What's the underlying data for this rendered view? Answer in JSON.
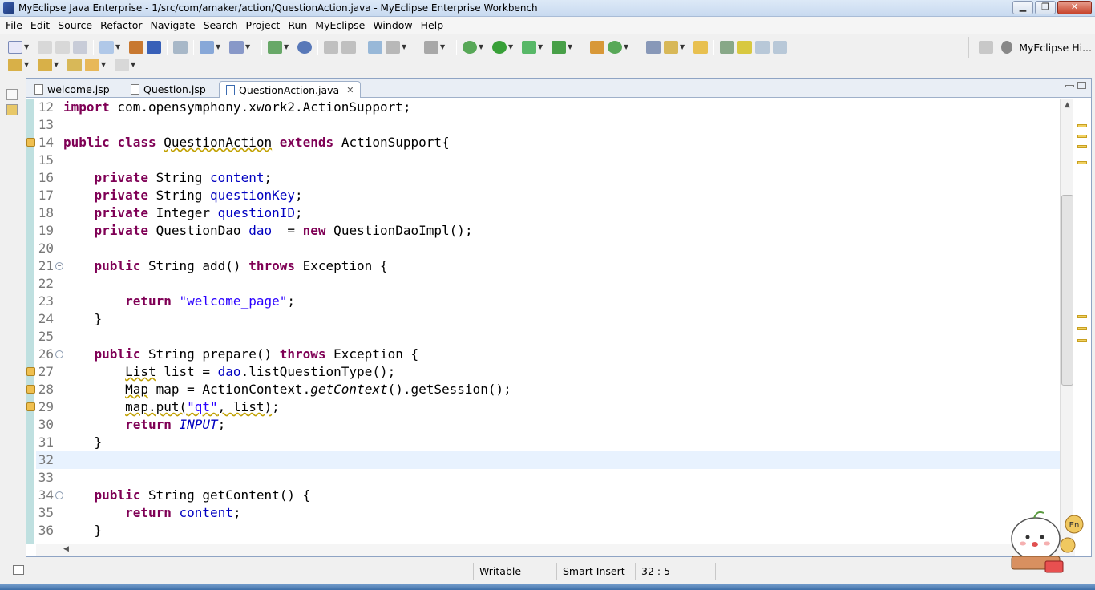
{
  "window": {
    "title": "MyEclipse Java Enterprise - 1/src/com/amaker/action/QuestionAction.java - MyEclipse Enterprise Workbench"
  },
  "menu": [
    "File",
    "Edit",
    "Source",
    "Refactor",
    "Navigate",
    "Search",
    "Project",
    "Run",
    "MyEclipse",
    "Window",
    "Help"
  ],
  "perspective": {
    "label": "MyEclipse Hi..."
  },
  "tabs": [
    {
      "label": "welcome.jsp"
    },
    {
      "label": "Question.jsp"
    },
    {
      "label": "QuestionAction.java",
      "close": "✕"
    }
  ],
  "code": {
    "current_line": 32,
    "lines": [
      {
        "n": "12",
        "t": "import com.opensymphony.xwork2.ActionSupport;"
      },
      {
        "n": "13",
        "t": ""
      },
      {
        "n": "14",
        "t": "public class QuestionAction extends ActionSupport{"
      },
      {
        "n": "15",
        "t": ""
      },
      {
        "n": "16",
        "t": "    private String content;"
      },
      {
        "n": "17",
        "t": "    private String questionKey;"
      },
      {
        "n": "18",
        "t": "    private Integer questionID;"
      },
      {
        "n": "19",
        "t": "    private QuestionDao dao  = new QuestionDaoImpl();"
      },
      {
        "n": "20",
        "t": ""
      },
      {
        "n": "21",
        "t": "    public String add() throws Exception {"
      },
      {
        "n": "22",
        "t": ""
      },
      {
        "n": "23",
        "t": "        return \"welcome_page\";"
      },
      {
        "n": "24",
        "t": "    }"
      },
      {
        "n": "25",
        "t": ""
      },
      {
        "n": "26",
        "t": "    public String prepare() throws Exception {"
      },
      {
        "n": "27",
        "t": "        List list = dao.listQuestionType();"
      },
      {
        "n": "28",
        "t": "        Map map = ActionContext.getContext().getSession();"
      },
      {
        "n": "29",
        "t": "        map.put(\"qt\", list);"
      },
      {
        "n": "30",
        "t": "        return INPUT;"
      },
      {
        "n": "31",
        "t": "    }"
      },
      {
        "n": "32",
        "t": ""
      },
      {
        "n": "33",
        "t": ""
      },
      {
        "n": "34",
        "t": "    public String getContent() {"
      },
      {
        "n": "35",
        "t": "        return content;"
      },
      {
        "n": "36",
        "t": "    }"
      }
    ]
  },
  "status": {
    "writable": "Writable",
    "insert_mode": "Smart Insert",
    "position": "32 : 5"
  },
  "ime": {
    "badge": "En"
  },
  "colors": {
    "keyword": "#7f0055",
    "field": "#0000c0",
    "string": "#2a00ff",
    "current_line": "#e8f2fe"
  }
}
